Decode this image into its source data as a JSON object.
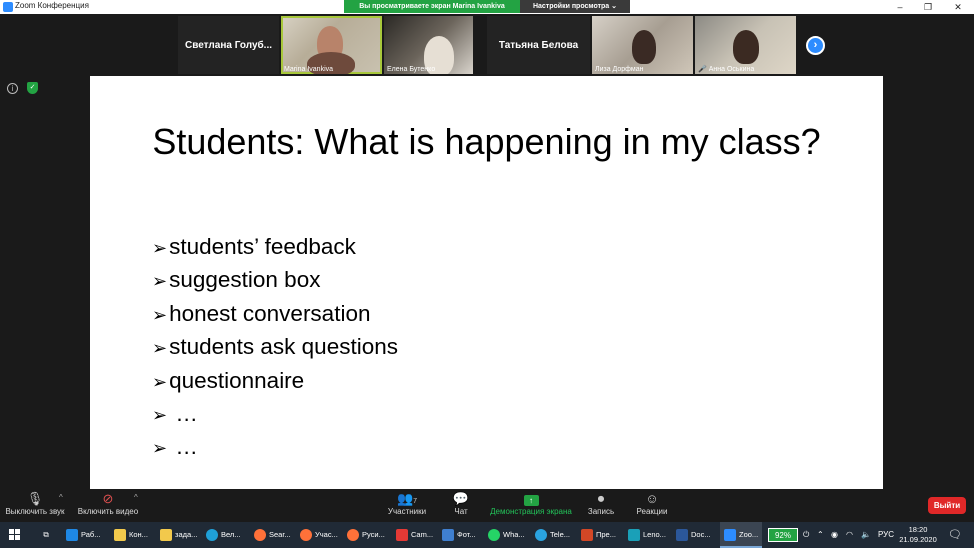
{
  "window": {
    "title": "Zoom Конференция",
    "share_banner": "Вы просматриваете экран Marina Ivankiva",
    "view_options": "Настройки просмотра"
  },
  "participants": [
    {
      "name": "Светлана Голуб..."
    },
    {
      "caption": "Marina Ivankiva"
    },
    {
      "caption": "Елена Бутенко"
    },
    {
      "name": "Татьяна Белова"
    },
    {
      "caption": "Лиза Дорфман"
    },
    {
      "caption": "Анна Оськина"
    }
  ],
  "slide": {
    "title": "Students: What is happening in my class?",
    "bullet_marker": "➢",
    "bullets": [
      "students’ feedback",
      "suggestion box",
      "honest conversation",
      "students ask questions",
      "questionnaire",
      " …",
      " …"
    ]
  },
  "toolbar": {
    "mute": "Выключить звук",
    "video": "Включить видео",
    "participants": "Участники",
    "participants_count": "7",
    "chat": "Чат",
    "share": "Демонстрация экрана",
    "record": "Запись",
    "reactions": "Реакции",
    "leave": "Выйти"
  },
  "taskbar": {
    "items": [
      "Раб...",
      "Кон...",
      "зада...",
      "Вел...",
      "Sear...",
      "Учас...",
      "Руси...",
      "Cam...",
      "Фот...",
      "Wha...",
      "Tele...",
      "Пре...",
      "Leno...",
      "Doc...",
      "Zoo..."
    ],
    "battery": "92%",
    "language": "РУС",
    "time": "18:20",
    "date": "21.09.2020"
  },
  "colors": {
    "zoom_blue": "#2d8cff",
    "share_green": "#23a343",
    "leave_red": "#e02828",
    "active_speaker": "#a8c83b"
  }
}
